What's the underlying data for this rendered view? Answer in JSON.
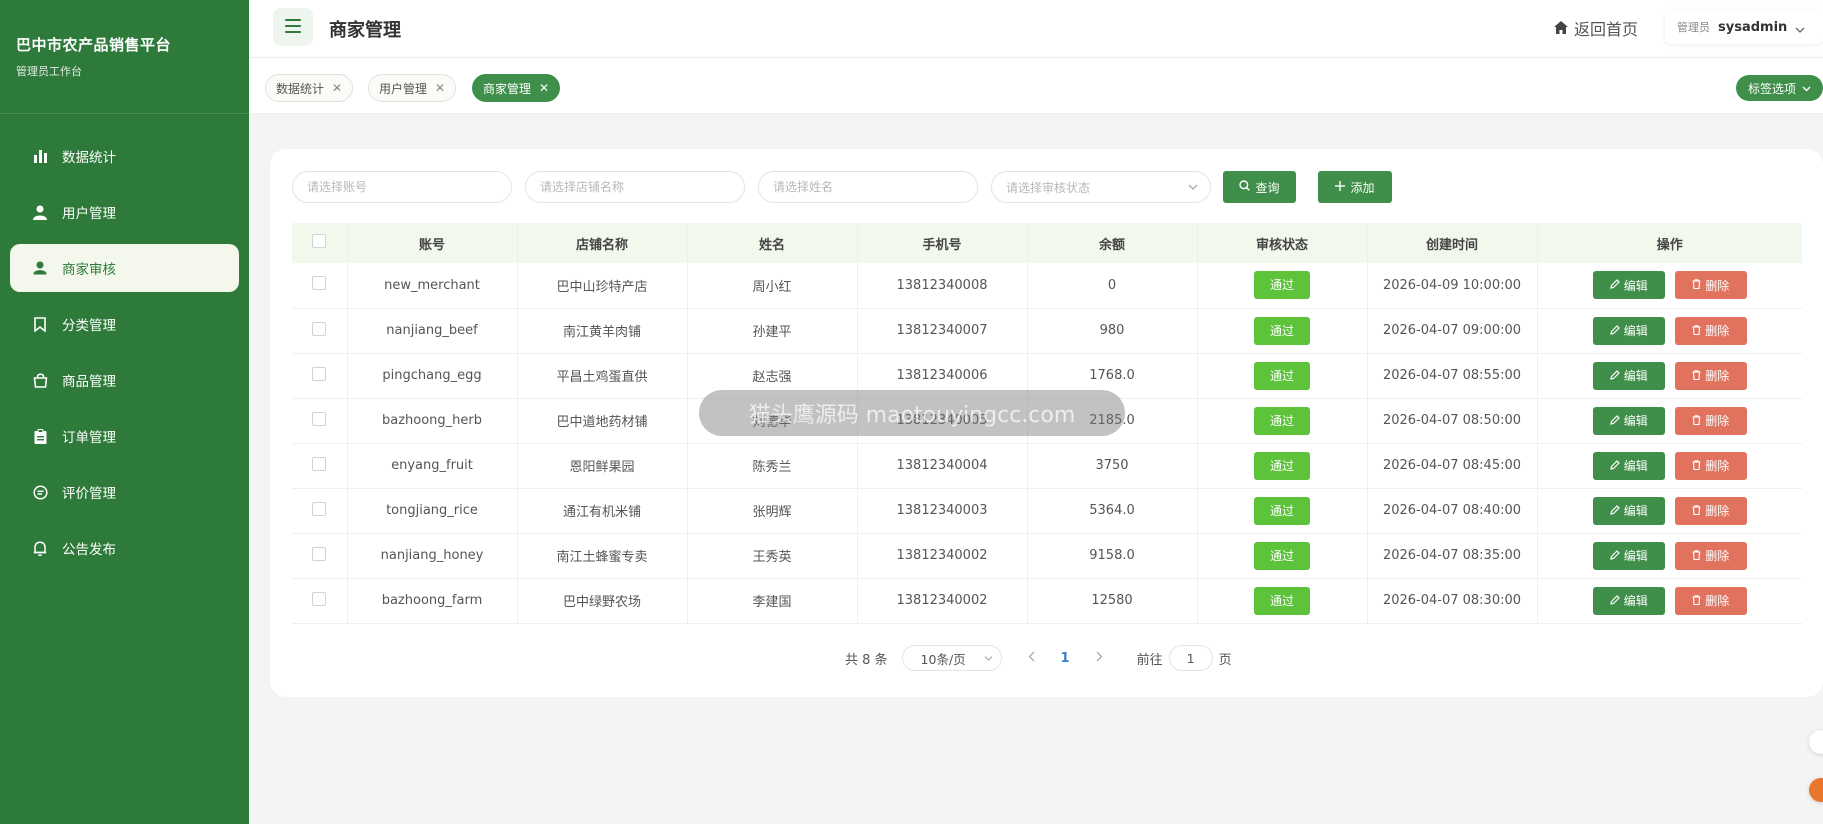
{
  "sidebar": {
    "brand_title": "巴中市农产品销售平台",
    "brand_sub": "管理员工作台",
    "items": [
      {
        "label": "数据统计",
        "icon": "bar-chart-icon"
      },
      {
        "label": "用户管理",
        "icon": "user-icon"
      },
      {
        "label": "商家审核",
        "icon": "merchant-audit-icon",
        "active": true
      },
      {
        "label": "分类管理",
        "icon": "bookmark-icon"
      },
      {
        "label": "商品管理",
        "icon": "shopping-bag-icon"
      },
      {
        "label": "订单管理",
        "icon": "clipboard-icon"
      },
      {
        "label": "评价管理",
        "icon": "chat-bubble-icon"
      },
      {
        "label": "公告发布",
        "icon": "bell-icon"
      }
    ]
  },
  "header": {
    "page_title": "商家管理",
    "home_label": "返回首页",
    "user_role": "管理员",
    "user_name": "sysadmin"
  },
  "tabs": {
    "items": [
      {
        "label": "数据统计"
      },
      {
        "label": "用户管理"
      },
      {
        "label": "商家管理",
        "active": true
      }
    ],
    "options_label": "标签选项"
  },
  "filters": {
    "account_placeholder": "请选择账号",
    "shop_placeholder": "请选择店铺名称",
    "name_placeholder": "请选择姓名",
    "status_placeholder": "请选择审核状态",
    "query_label": "查询",
    "add_label": "添加"
  },
  "table": {
    "columns": [
      "账号",
      "店铺名称",
      "姓名",
      "手机号",
      "余额",
      "审核状态",
      "创建时间",
      "操作"
    ],
    "rows": [
      {
        "account": "new_merchant",
        "shop": "巴中山珍特产店",
        "name": "周小红",
        "phone": "13812340008",
        "balance": "0",
        "status": "通过",
        "created": "2026-04-09 10:00:00"
      },
      {
        "account": "nanjiang_beef",
        "shop": "南江黄羊肉铺",
        "name": "孙建平",
        "phone": "13812340007",
        "balance": "980",
        "status": "通过",
        "created": "2026-04-07 09:00:00"
      },
      {
        "account": "pingchang_egg",
        "shop": "平昌土鸡蛋直供",
        "name": "赵志强",
        "phone": "13812340006",
        "balance": "1768.0",
        "status": "通过",
        "created": "2026-04-07 08:55:00"
      },
      {
        "account": "bazhoong_herb",
        "shop": "巴中道地药材铺",
        "name": "刘德华",
        "phone": "13812340005",
        "balance": "2185.0",
        "status": "通过",
        "created": "2026-04-07 08:50:00"
      },
      {
        "account": "enyang_fruit",
        "shop": "恩阳鲜果园",
        "name": "陈秀兰",
        "phone": "13812340004",
        "balance": "3750",
        "status": "通过",
        "created": "2026-04-07 08:45:00"
      },
      {
        "account": "tongjiang_rice",
        "shop": "通江有机米铺",
        "name": "张明辉",
        "phone": "13812340003",
        "balance": "5364.0",
        "status": "通过",
        "created": "2026-04-07 08:40:00"
      },
      {
        "account": "nanjiang_honey",
        "shop": "南江土蜂蜜专卖",
        "name": "王秀英",
        "phone": "13812340002",
        "balance": "9158.0",
        "status": "通过",
        "created": "2026-04-07 08:35:00"
      },
      {
        "account": "bazhoong_farm",
        "shop": "巴中绿野农场",
        "name": "李建国",
        "phone": "13812340002",
        "balance": "12580",
        "status": "通过",
        "created": "2026-04-07 08:30:00"
      }
    ],
    "edit_label": "编辑",
    "delete_label": "删除"
  },
  "pagination": {
    "total_text": "共 8 条",
    "page_size": "10条/页",
    "current_page": "1",
    "goto_label": "前往",
    "goto_value": "1",
    "page_suffix": "页"
  },
  "watermark": "猫头鹰源码 maotouyingcc.com",
  "colors": {
    "primary": "#3f8e49",
    "sidebar": "#2e7a3a",
    "success": "#5cc33a",
    "danger": "#e0725e"
  }
}
